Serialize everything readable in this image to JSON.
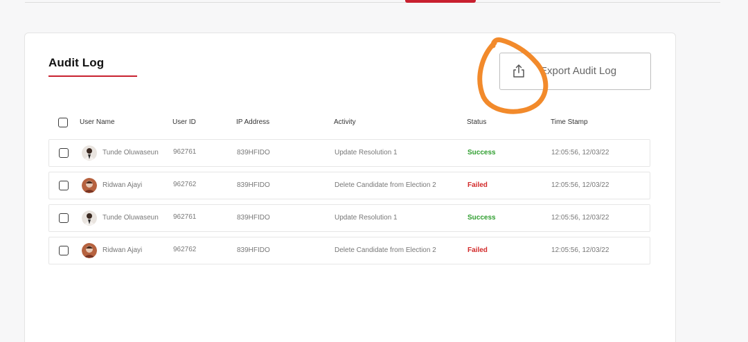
{
  "section": {
    "title": "Audit Log",
    "export_label": "Export Audit Log"
  },
  "icons": {
    "export": "share-upload-icon"
  },
  "colors": {
    "accent": "#c8202f",
    "success": "#2f9e2f",
    "failed": "#d22a2a",
    "annotation": "#f28a2b"
  },
  "table": {
    "headers": [
      "User Name",
      "User ID",
      "IP Address",
      "Activity",
      "Status",
      "Time Stamp"
    ],
    "rows": [
      {
        "user_name": "Tunde Oluwaseun",
        "user_id": "962761",
        "ip": "839HFIDO",
        "activity": "Update Resolution 1",
        "status": "Success",
        "timestamp": "12:05:56, 12/03/22"
      },
      {
        "user_name": "Ridwan Ajayi",
        "user_id": "962762",
        "ip": "839HFIDO",
        "activity": "Delete Candidate from Election 2",
        "status": "Failed",
        "timestamp": "12:05:56, 12/03/22"
      },
      {
        "user_name": "Tunde Oluwaseun",
        "user_id": "962761",
        "ip": "839HFIDO",
        "activity": "Update Resolution 1",
        "status": "Success",
        "timestamp": "12:05:56, 12/03/22"
      },
      {
        "user_name": "Ridwan Ajayi",
        "user_id": "962762",
        "ip": "839HFIDO",
        "activity": "Delete Candidate from Election 2",
        "status": "Failed",
        "timestamp": "12:05:56, 12/03/22"
      }
    ]
  }
}
